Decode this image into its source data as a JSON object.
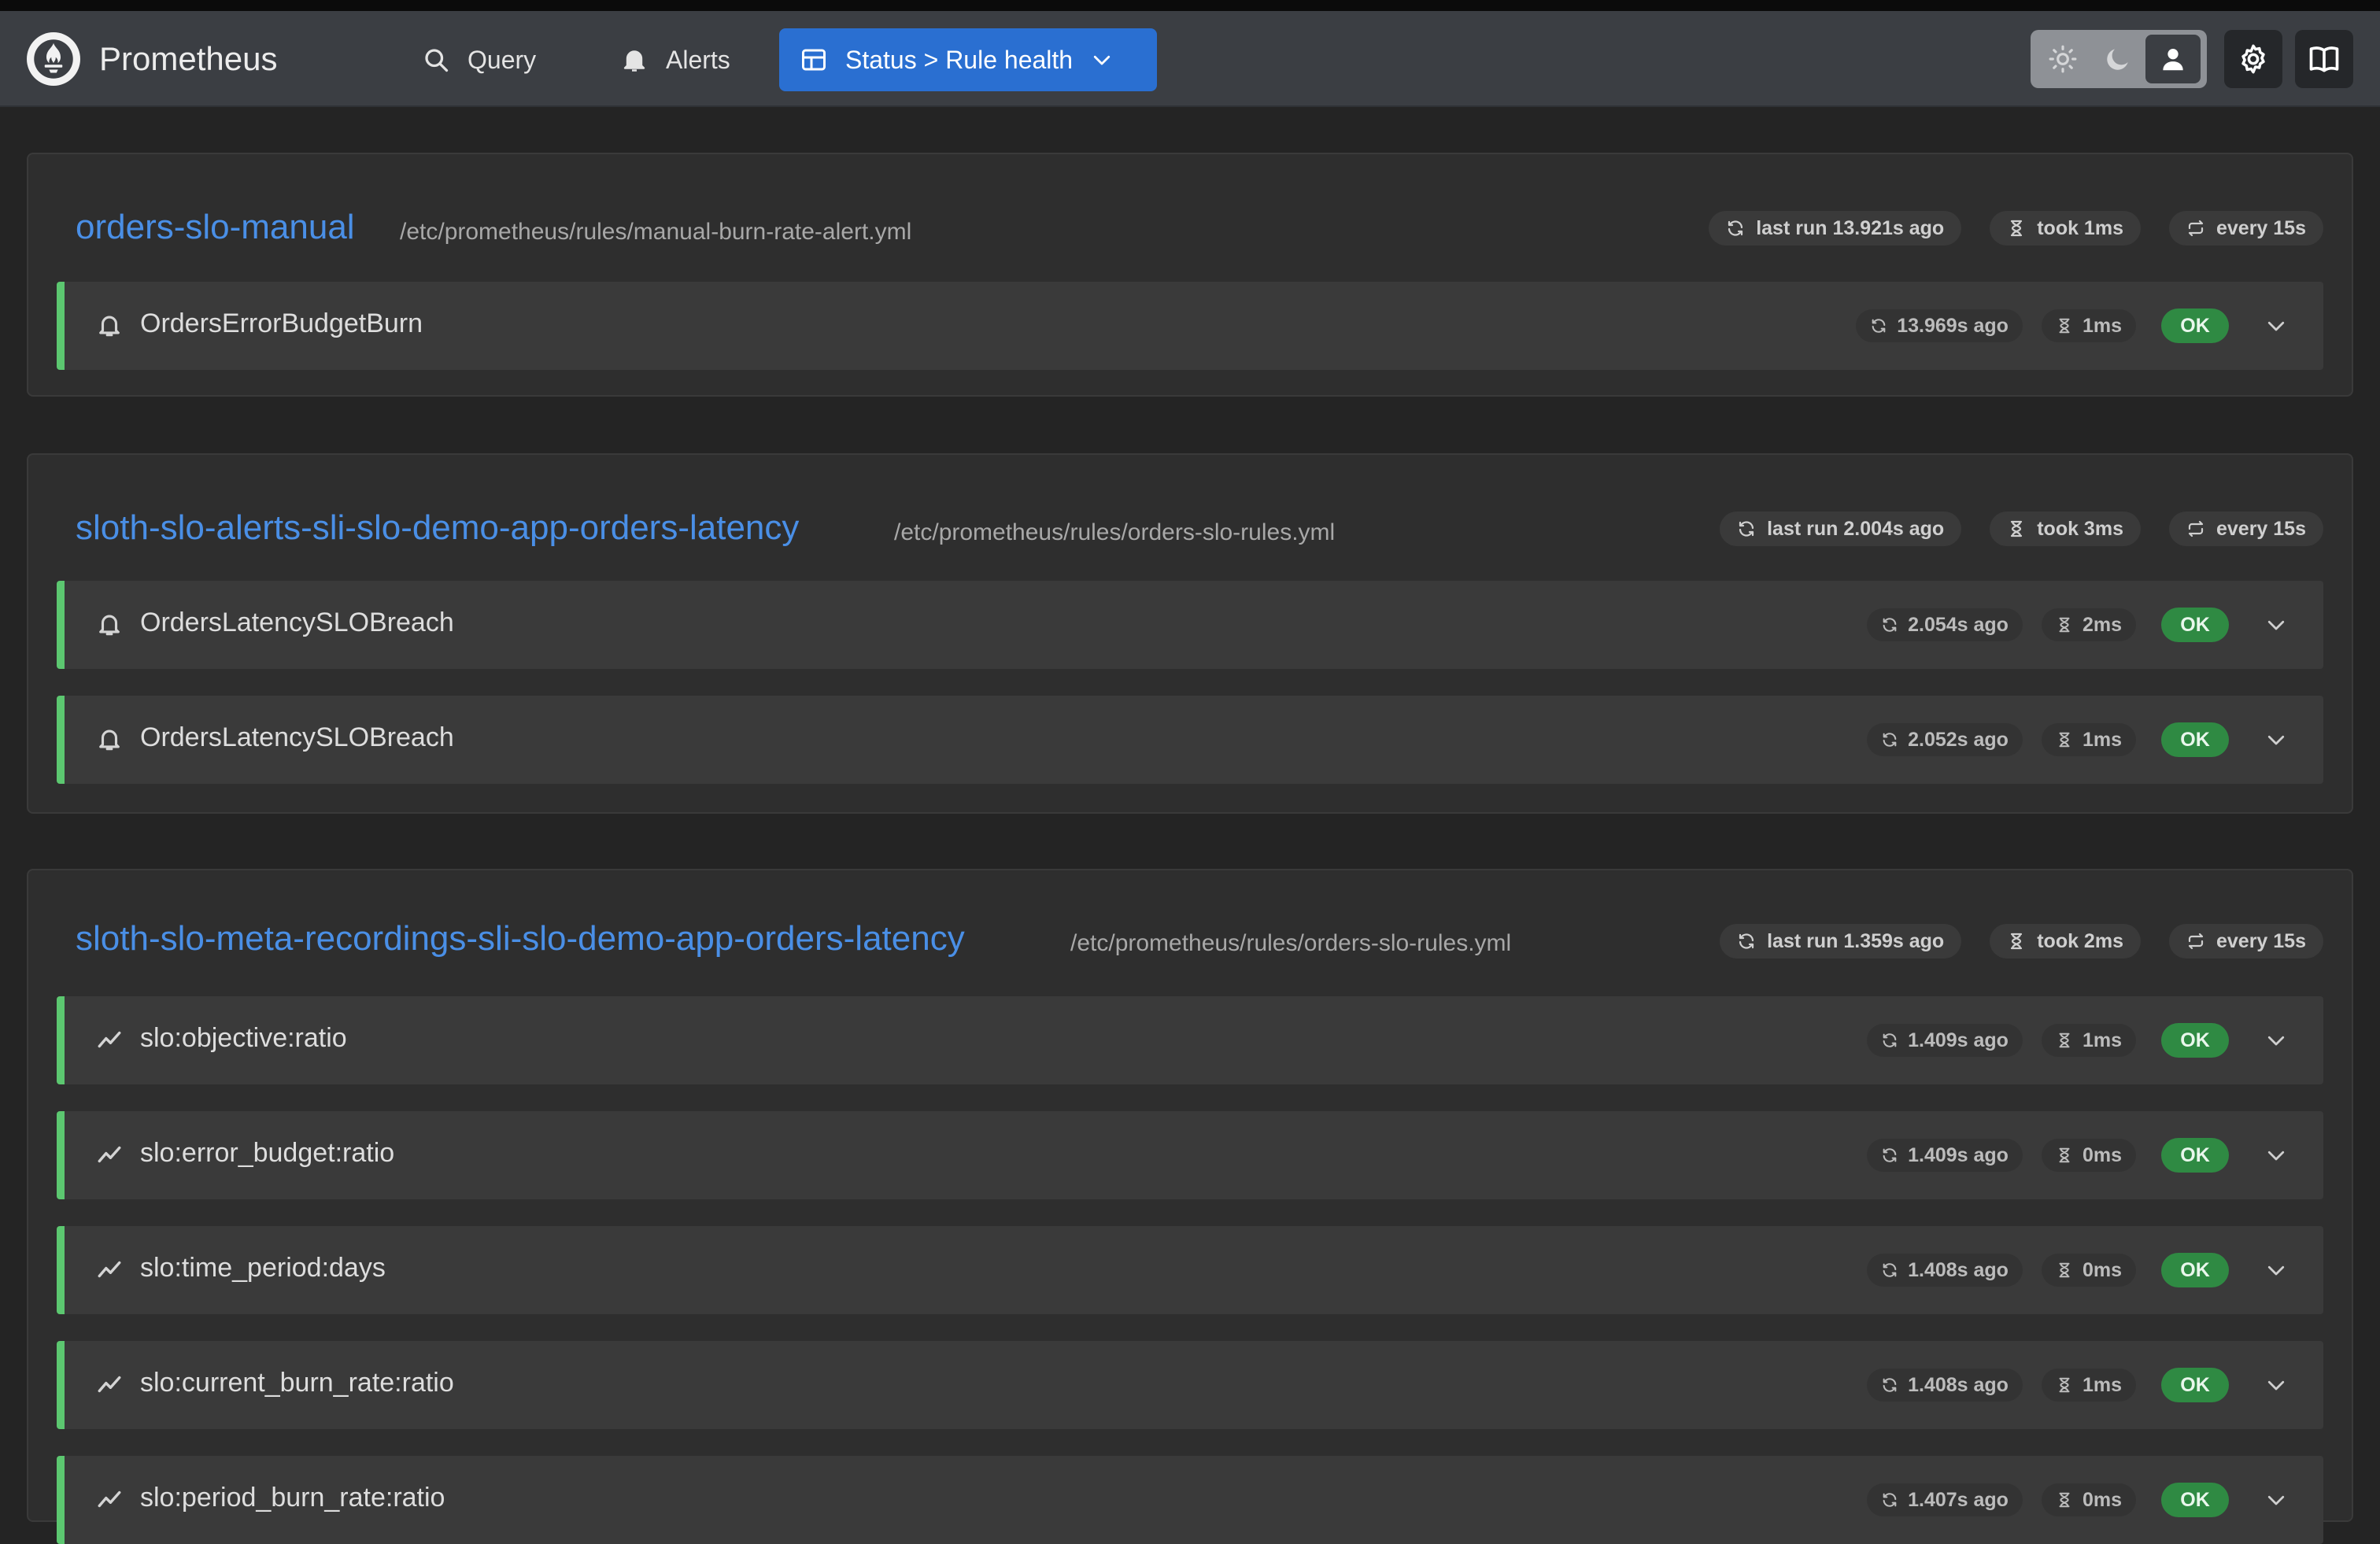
{
  "app": {
    "name": "Prometheus"
  },
  "nav": {
    "query_label": "Query",
    "alerts_label": "Alerts",
    "status_label": "Status > Rule health"
  },
  "colors": {
    "accent": "#2a6fd1",
    "group_title": "#4a8fe6",
    "healthy_bar": "#5cc770",
    "ok_badge": "#2f8a43"
  },
  "groups": [
    {
      "name": "orders-slo-manual",
      "file": "/etc/prometheus/rules/manual-burn-rate-alert.yml",
      "last_run": "last run 13.921s ago",
      "took": "took 1ms",
      "interval": "every 15s",
      "rules": [
        {
          "type": "alert",
          "icon": "bell-icon",
          "name": "OrdersErrorBudgetBurn",
          "last_eval": "13.969s ago",
          "duration": "1ms",
          "health": "OK"
        }
      ]
    },
    {
      "name": "sloth-slo-alerts-sli-slo-demo-app-orders-latency",
      "file": "/etc/prometheus/rules/orders-slo-rules.yml",
      "last_run": "last run 2.004s ago",
      "took": "took 3ms",
      "interval": "every 15s",
      "rules": [
        {
          "type": "alert",
          "icon": "bell-icon",
          "name": "OrdersLatencySLOBreach",
          "last_eval": "2.054s ago",
          "duration": "2ms",
          "health": "OK"
        },
        {
          "type": "alert",
          "icon": "bell-icon",
          "name": "OrdersLatencySLOBreach",
          "last_eval": "2.052s ago",
          "duration": "1ms",
          "health": "OK"
        }
      ]
    },
    {
      "name": "sloth-slo-meta-recordings-sli-slo-demo-app-orders-latency",
      "file": "/etc/prometheus/rules/orders-slo-rules.yml",
      "last_run": "last run 1.359s ago",
      "took": "took 2ms",
      "interval": "every 15s",
      "rules": [
        {
          "type": "recording",
          "icon": "chart-line-icon",
          "name": "slo:objective:ratio",
          "last_eval": "1.409s ago",
          "duration": "1ms",
          "health": "OK"
        },
        {
          "type": "recording",
          "icon": "chart-line-icon",
          "name": "slo:error_budget:ratio",
          "last_eval": "1.409s ago",
          "duration": "0ms",
          "health": "OK"
        },
        {
          "type": "recording",
          "icon": "chart-line-icon",
          "name": "slo:time_period:days",
          "last_eval": "1.408s ago",
          "duration": "0ms",
          "health": "OK"
        },
        {
          "type": "recording",
          "icon": "chart-line-icon",
          "name": "slo:current_burn_rate:ratio",
          "last_eval": "1.408s ago",
          "duration": "1ms",
          "health": "OK"
        },
        {
          "type": "recording",
          "icon": "chart-line-icon",
          "name": "slo:period_burn_rate:ratio",
          "last_eval": "1.407s ago",
          "duration": "0ms",
          "health": "OK"
        }
      ]
    }
  ]
}
